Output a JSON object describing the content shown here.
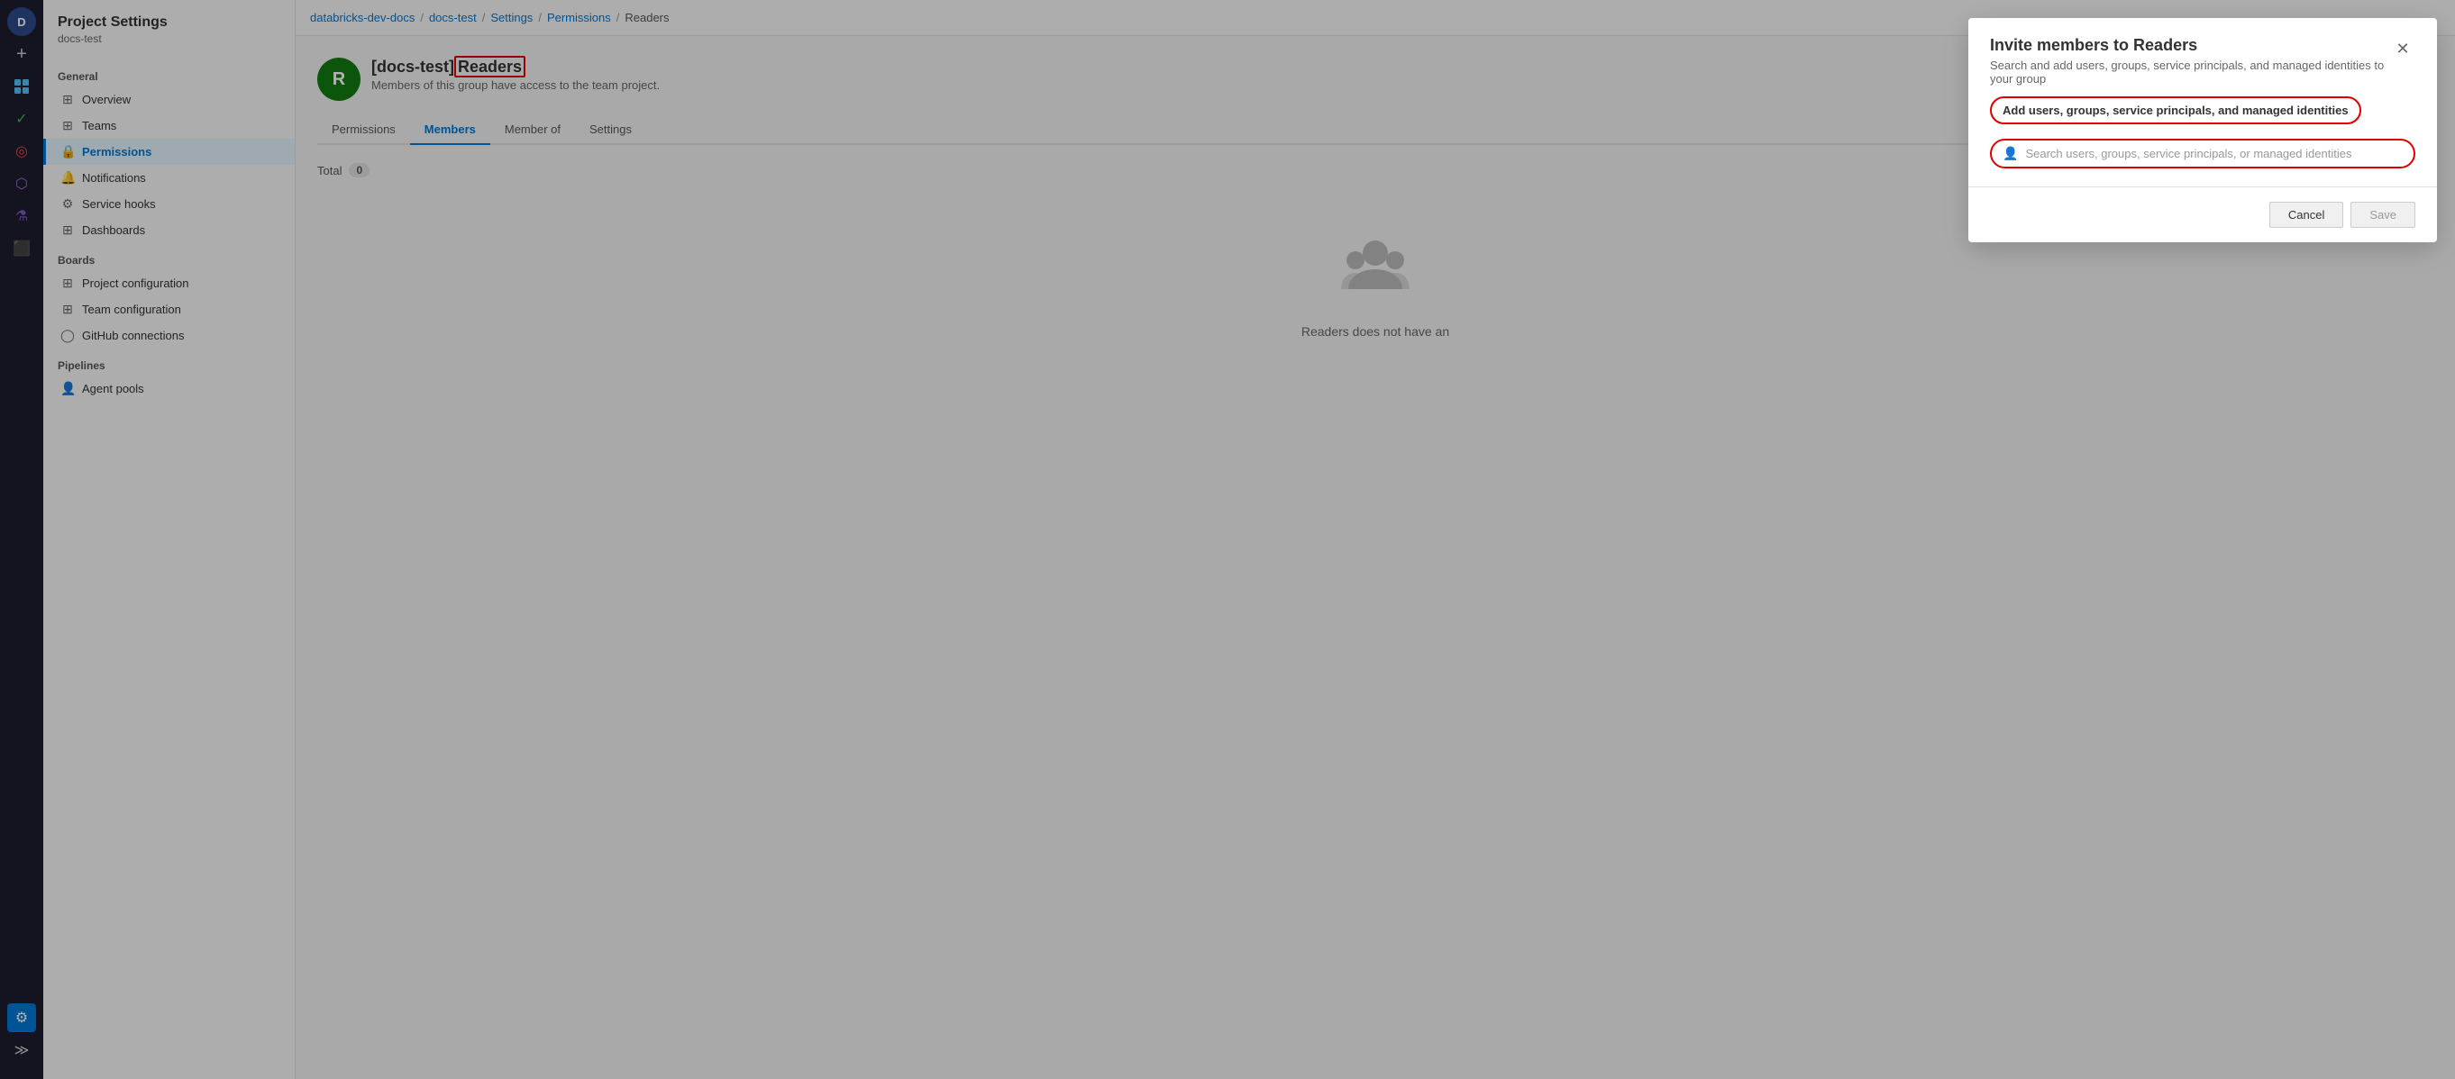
{
  "iconBar": {
    "avatarLabel": "D",
    "addLabel": "+",
    "icons": [
      "boards",
      "checkmark",
      "target",
      "puzzle",
      "flask",
      "package"
    ],
    "bottomIcons": [
      "settings",
      "expand"
    ]
  },
  "topBar": {
    "items": [
      "databricks-dev-docs",
      "/",
      "docs-test",
      "/",
      "Settings",
      "/",
      "Permissions",
      "/",
      "Readers"
    ]
  },
  "sidebar": {
    "title": "Project Settings",
    "subtitle": "docs-test",
    "general": {
      "label": "General",
      "items": [
        {
          "id": "overview",
          "label": "Overview",
          "icon": "⊞"
        },
        {
          "id": "teams",
          "label": "Teams",
          "icon": "⊞"
        },
        {
          "id": "permissions",
          "label": "Permissions",
          "icon": "🔒"
        },
        {
          "id": "notifications",
          "label": "Notifications",
          "icon": "🔔"
        },
        {
          "id": "service-hooks",
          "label": "Service hooks",
          "icon": "⚙"
        },
        {
          "id": "dashboards",
          "label": "Dashboards",
          "icon": "⊞"
        }
      ]
    },
    "boards": {
      "label": "Boards",
      "items": [
        {
          "id": "project-configuration",
          "label": "Project configuration",
          "icon": "⊞"
        },
        {
          "id": "team-configuration",
          "label": "Team configuration",
          "icon": "⊞"
        },
        {
          "id": "github-connections",
          "label": "GitHub connections",
          "icon": "◯"
        }
      ]
    },
    "pipelines": {
      "label": "Pipelines",
      "items": [
        {
          "id": "agent-pools",
          "label": "Agent pools",
          "icon": "👤"
        }
      ]
    }
  },
  "content": {
    "groupAvatarLabel": "R",
    "titlePrefix": "[docs-test]",
    "titleHighlighted": "Readers",
    "subtitle": "Members of this group have access to the team project.",
    "tabs": [
      {
        "id": "permissions",
        "label": "Permissions"
      },
      {
        "id": "members",
        "label": "Members",
        "active": true
      },
      {
        "id": "member-of",
        "label": "Member of"
      },
      {
        "id": "settings",
        "label": "Settings"
      }
    ],
    "totalLabel": "Total",
    "totalCount": "0",
    "emptyMessage": "Readers does not have an"
  },
  "dialog": {
    "title": "Invite members to Readers",
    "subtitle": "Search and add users, groups, service principals, and managed identities to your group",
    "addLabel": "Add users, groups, service principals, and managed identities",
    "searchPlaceholder": "Search users, groups, service principals, or managed identities",
    "cancelLabel": "Cancel",
    "saveLabel": "Save"
  }
}
